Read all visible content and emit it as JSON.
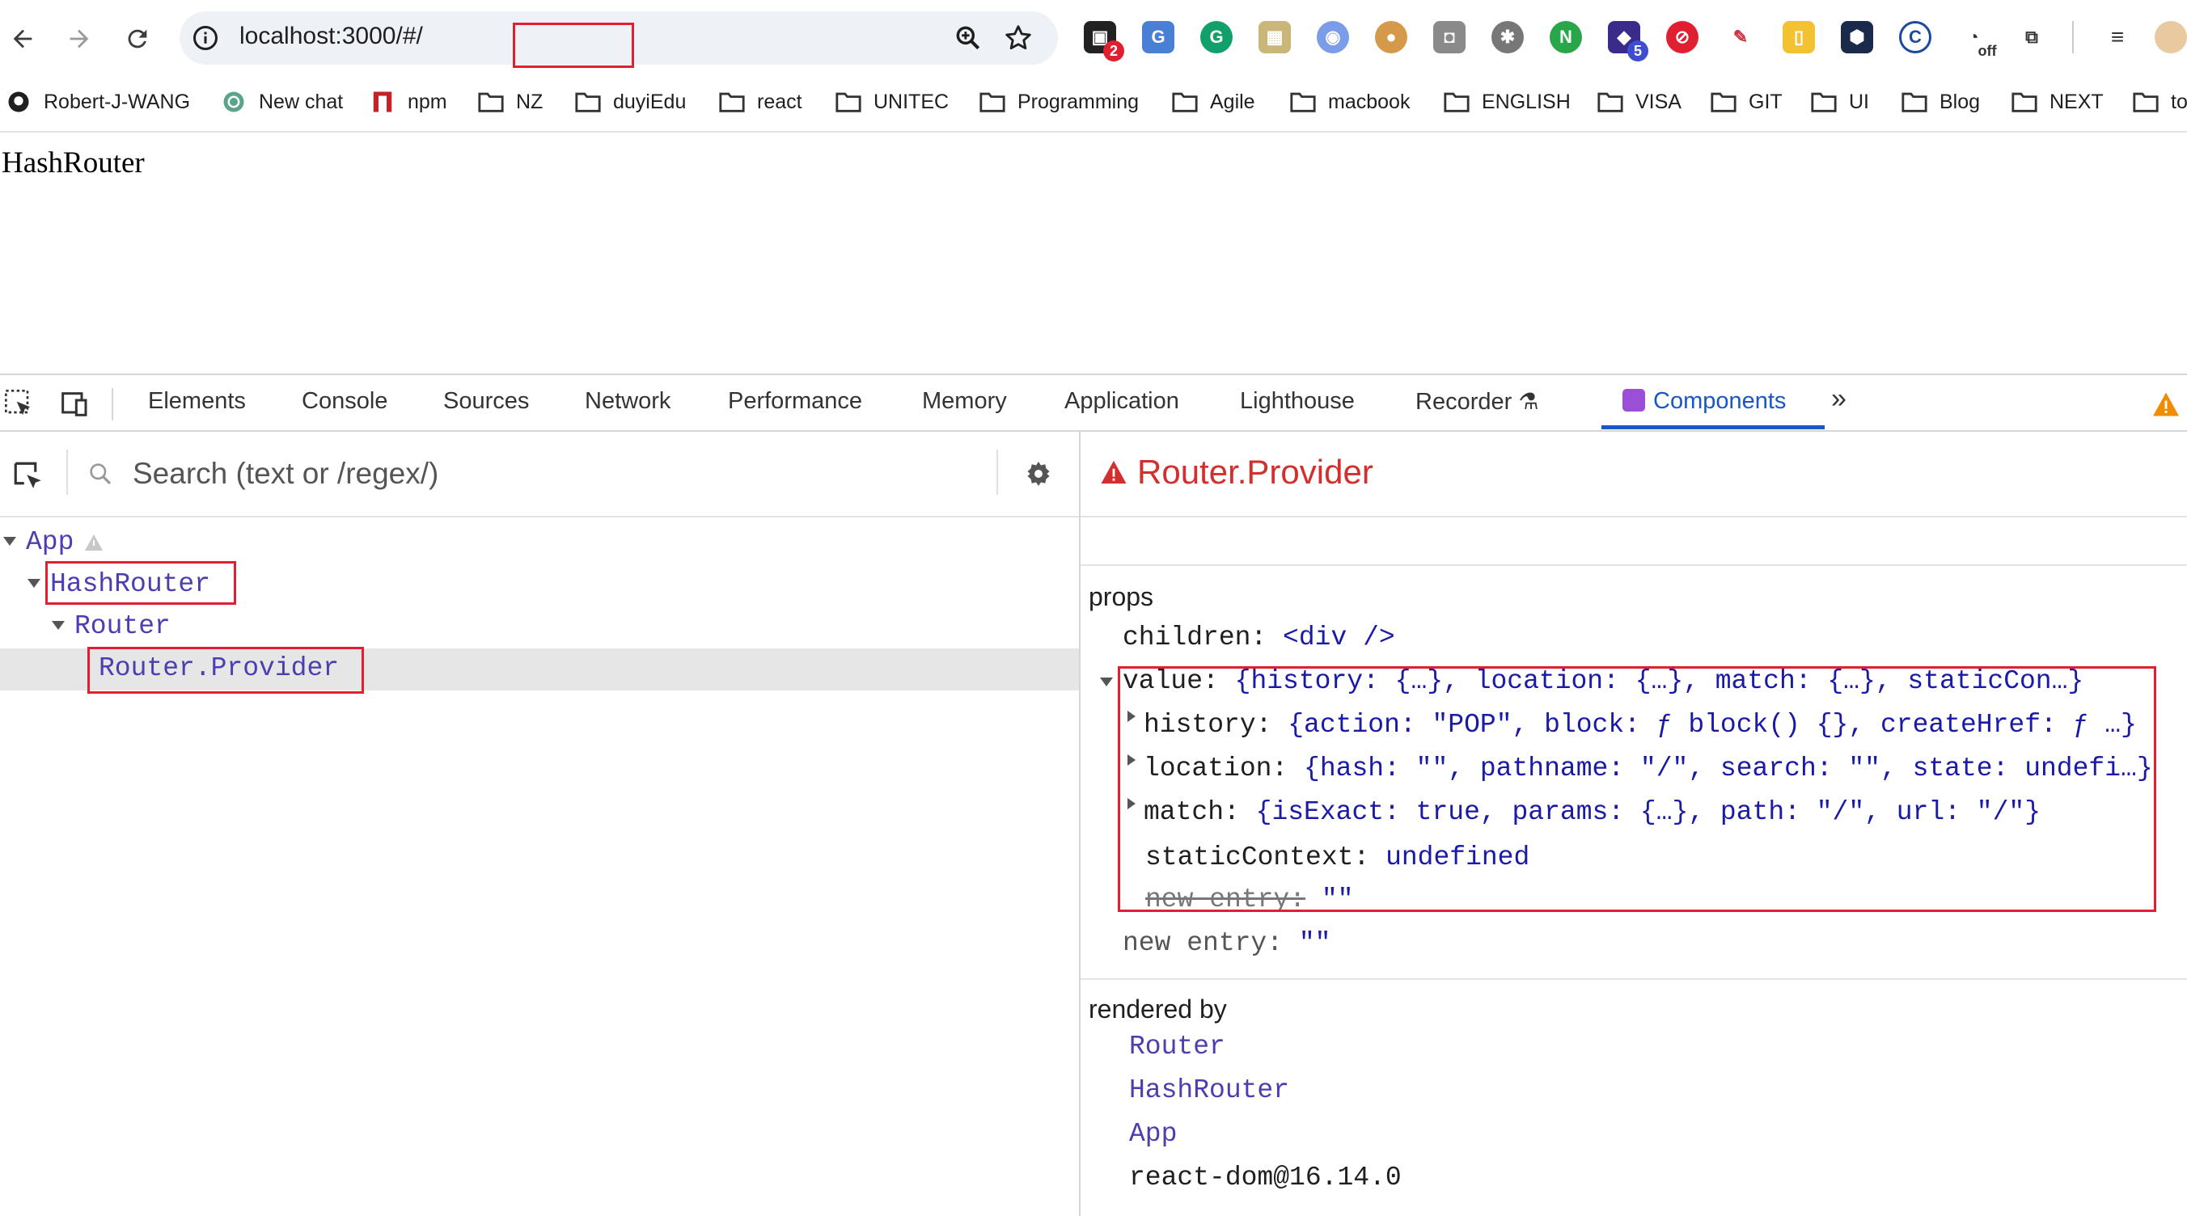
{
  "browser": {
    "url_host": "localhost",
    "url_port_hash": ":3000/#/",
    "extension_badges": {
      "ext1": "2",
      "ext7": "5",
      "ext15": "off"
    }
  },
  "bookmarks": [
    {
      "label": "Robert-J-WANG",
      "icon": "github-icon"
    },
    {
      "label": "New chat",
      "icon": "openai-icon"
    },
    {
      "label": "npm",
      "icon": "npm-icon"
    },
    {
      "label": "NZ",
      "icon": "folder-icon"
    },
    {
      "label": "duyiEdu",
      "icon": "folder-icon"
    },
    {
      "label": "react",
      "icon": "folder-icon"
    },
    {
      "label": "UNITEC",
      "icon": "folder-icon"
    },
    {
      "label": "Programming",
      "icon": "folder-icon"
    },
    {
      "label": "Agile",
      "icon": "folder-icon"
    },
    {
      "label": "macbook",
      "icon": "folder-icon"
    },
    {
      "label": "ENGLISH",
      "icon": "folder-icon"
    },
    {
      "label": "VISA",
      "icon": "folder-icon"
    },
    {
      "label": "GIT",
      "icon": "folder-icon"
    },
    {
      "label": "UI",
      "icon": "folder-icon"
    },
    {
      "label": "Blog",
      "icon": "folder-icon"
    },
    {
      "label": "NEXT",
      "icon": "folder-icon"
    },
    {
      "label": "to",
      "icon": "folder-icon"
    }
  ],
  "page": {
    "heading": "HashRouter"
  },
  "devtools": {
    "tabs": [
      "Elements",
      "Console",
      "Sources",
      "Network",
      "Performance",
      "Memory",
      "Application",
      "Lighthouse",
      "Recorder",
      "Components"
    ],
    "active_tab": "Components",
    "search_placeholder": "Search (text or /regex/)",
    "tree": [
      {
        "label": "App",
        "depth": 0,
        "warning": true
      },
      {
        "label": "HashRouter",
        "depth": 1,
        "highlighted": true
      },
      {
        "label": "Router",
        "depth": 2
      },
      {
        "label": "Router.Provider",
        "depth": 3,
        "selected": true,
        "highlighted": true
      }
    ],
    "inspector": {
      "title": "Router.Provider",
      "props_label": "props",
      "children_key": "children:",
      "children_value": "<div />",
      "value_key": "value:",
      "value_summary": "{history: {…}, location: {…}, match: {…}, staticCon…}",
      "history_key": "history:",
      "history_value": "{action: \"POP\", block: ƒ block() {}, createHref: ƒ …}",
      "location_key": "location:",
      "location_value": "{hash: \"\", pathname: \"/\", search: \"\", state: undefi…}",
      "match_key": "match:",
      "match_value": "{isExact: true, params: {…}, path: \"/\", url: \"/\"}",
      "static_key": "staticContext:",
      "static_value": "undefined",
      "new_entry_key": "new entry:",
      "new_entry_value": "\"\"",
      "rendered_by_label": "rendered by",
      "rendered_by": [
        "Router",
        "HashRouter",
        "App",
        "react-dom@16.14.0"
      ]
    }
  },
  "colors": {
    "highlight_red": "#e02030",
    "react_blue": "#1a56c8",
    "component_purple": "#4b3fb0"
  }
}
